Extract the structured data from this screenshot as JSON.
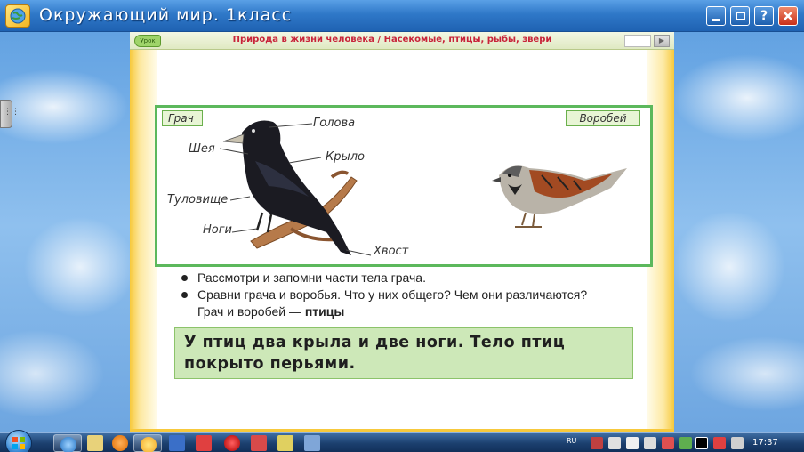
{
  "window": {
    "title": "Окружающий мир. 1класс",
    "buttons": {
      "minimize_icon": "minimize-icon",
      "maximize_icon": "restore-icon",
      "help_label": "?",
      "close_icon": "close-icon"
    }
  },
  "page_header": {
    "lesson_tab": "Урок",
    "title": "Природа в жизни человека / Насекомые, птицы, рыбы, звери",
    "page_input_value": "",
    "go_icon": "play-arrow-icon"
  },
  "illustration": {
    "rook_tag": "Грач",
    "sparrow_tag": "Воробей",
    "parts": {
      "head": "Голова",
      "neck": "Шея",
      "wing": "Крыло",
      "body": "Туловище",
      "legs": "Ноги",
      "tail": "Хвост"
    }
  },
  "bullets": [
    "Рассмотри и запомни части тела грача.",
    "Сравни грача и воробья. Что у них общего? Чем они различаются?"
  ],
  "answer": {
    "prefix": "Грач и воробей —",
    "bold": "птицы"
  },
  "rule": "У птиц два крыла и две ноги. Тело птиц покрыто перьями.",
  "taskbar": {
    "language": "RU",
    "clock": "17:37"
  },
  "colors": {
    "header_title": "#c8243a",
    "frame_green": "#5cb85c",
    "rule_bg": "#cde8b8",
    "page_yellow": "#f7c93c"
  }
}
